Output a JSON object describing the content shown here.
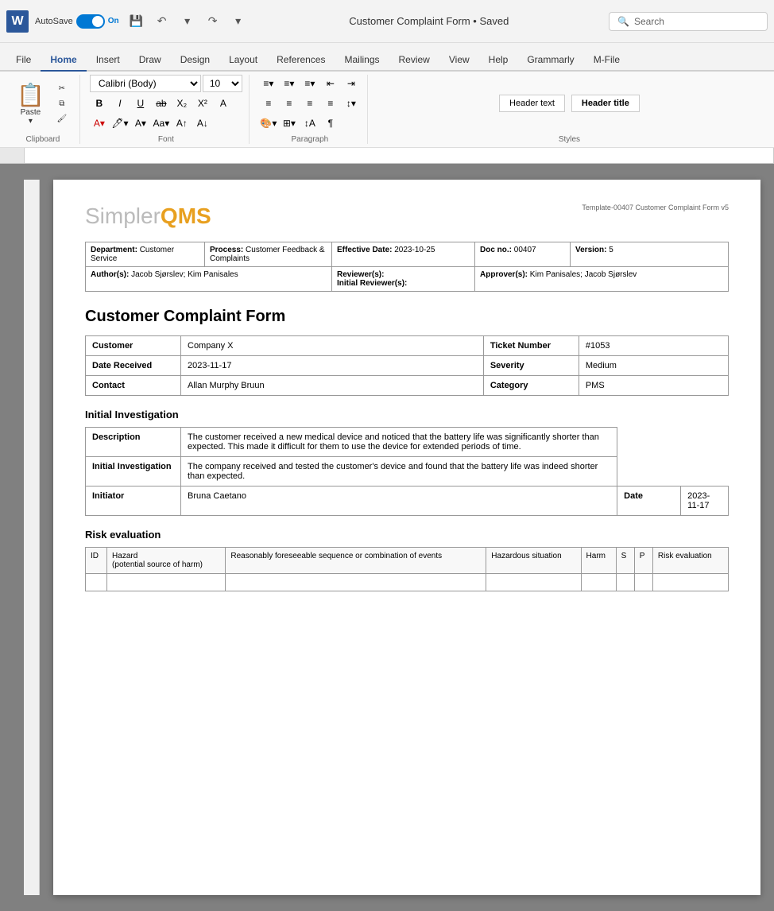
{
  "titlebar": {
    "app_name": "W",
    "autosave_label": "AutoSave",
    "toggle_state": "On",
    "doc_title": "Customer Complaint Form • Saved",
    "search_placeholder": "Search",
    "undo_icon": "↶",
    "redo_icon": "↷"
  },
  "ribbon": {
    "tabs": [
      "File",
      "Home",
      "Insert",
      "Draw",
      "Design",
      "Layout",
      "References",
      "Mailings",
      "Review",
      "View",
      "Help",
      "Grammarly",
      "M-File"
    ],
    "active_tab": "Home",
    "clipboard_label": "Clipboard",
    "paste_label": "Paste",
    "font_label": "Font",
    "paragraph_label": "Paragraph",
    "styles_label": "Styles",
    "font_name": "Calibri (Body)",
    "font_size": "10",
    "style_header_text": "Header text",
    "style_header_title": "Header title"
  },
  "document": {
    "logo_text": "Simpler",
    "logo_qms": "QMS",
    "template_ref": "Template-00407 Customer Complaint Form v5",
    "meta": {
      "department_label": "Department:",
      "department_value": "Customer Service",
      "process_label": "Process:",
      "process_value": "Customer Feedback & Complaints",
      "effective_date_label": "Effective Date:",
      "effective_date_value": "2023-10-25",
      "doc_no_label": "Doc no.:",
      "doc_no_value": "00407",
      "version_label": "Version:",
      "version_value": "5",
      "author_label": "Author(s):",
      "author_value": "Jacob Sjørslev; Kim Panisales",
      "reviewer_label": "Reviewer(s):",
      "reviewer_value": "",
      "initial_reviewer_label": "Initial Reviewer(s):",
      "initial_reviewer_value": "",
      "approver_label": "Approver(s):",
      "approver_value": "Kim Panisales; Jacob Sjørslev"
    },
    "title": "Customer Complaint Form",
    "customer_label": "Customer",
    "customer_value": "Company X",
    "ticket_number_label": "Ticket Number",
    "ticket_number_value": "#1053",
    "date_received_label": "Date Received",
    "date_received_value": "2023-11-17",
    "severity_label": "Severity",
    "severity_value": "Medium",
    "contact_label": "Contact",
    "contact_value": "Allan Murphy Bruun",
    "category_label": "Category",
    "category_value": "PMS",
    "initial_investigation_title": "Initial Investigation",
    "description_label": "Description",
    "description_value": "The customer received a new medical device and noticed that the battery life was significantly shorter than expected. This made it difficult for them to use the device for extended periods of time.",
    "investigation_label": "Initial Investigation",
    "investigation_value": "The company received and tested the customer's device and found that the battery life was indeed shorter than expected.",
    "initiator_label": "Initiator",
    "initiator_value": "Bruna Caetano",
    "date_label": "Date",
    "date_value": "2023-11-17",
    "risk_evaluation_title": "Risk evaluation",
    "risk_columns": [
      "ID",
      "Hazard\n(potential source of harm)",
      "Reasonably foreseeable sequence or combination of events",
      "Hazardous situation",
      "Harm",
      "S",
      "P",
      "Risk evaluation"
    ]
  }
}
